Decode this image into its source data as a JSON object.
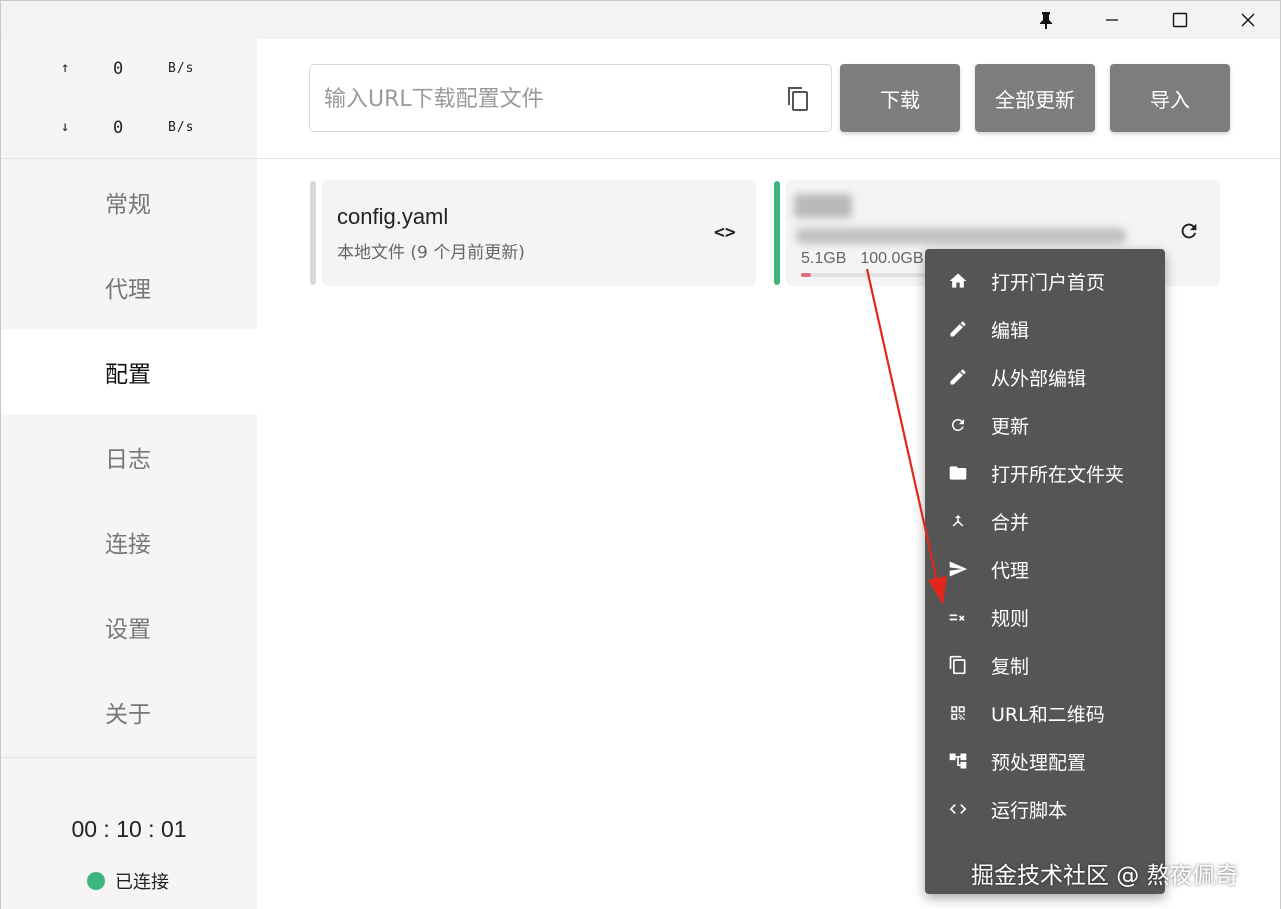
{
  "titlebar": {
    "pin_icon": "pin-icon",
    "minimize_icon": "minimize-icon",
    "maximize_icon": "maximize-icon",
    "close_icon": "close-icon"
  },
  "traffic": {
    "up": {
      "arrow": "↑",
      "value": "0",
      "unit": "B/s"
    },
    "down": {
      "arrow": "↓",
      "value": "0",
      "unit": "B/s"
    }
  },
  "nav": {
    "items": [
      {
        "label": "常规"
      },
      {
        "label": "代理"
      },
      {
        "label": "配置"
      },
      {
        "label": "日志"
      },
      {
        "label": "连接"
      },
      {
        "label": "设置"
      },
      {
        "label": "关于"
      }
    ],
    "active": "配置"
  },
  "status": {
    "timer": "00 : 10 : 01",
    "connection": "已连接",
    "connection_color": "#3db67c"
  },
  "toolbar": {
    "url_placeholder": "输入URL下载配置文件",
    "url_value": "",
    "download_label": "下载",
    "update_all_label": "全部更新",
    "import_label": "导入"
  },
  "profiles": [
    {
      "name": "config.yaml",
      "subtitle": "本地文件 (9 个月前更新)",
      "icon": "code-icon"
    },
    {
      "used": "5.1GB",
      "total": "100.0GB",
      "usage_fraction": 0.051,
      "icon": "refresh-icon",
      "accent": "#3db67c"
    }
  ],
  "context_menu": {
    "items": [
      {
        "label": "打开门户首页",
        "icon": "home-icon"
      },
      {
        "label": "编辑",
        "icon": "pencil-icon"
      },
      {
        "label": "从外部编辑",
        "icon": "pencil-icon"
      },
      {
        "label": "更新",
        "icon": "refresh-icon"
      },
      {
        "label": "打开所在文件夹",
        "icon": "folder-icon"
      },
      {
        "label": "合并",
        "icon": "merge-icon"
      },
      {
        "label": "代理",
        "icon": "send-icon"
      },
      {
        "label": "规则",
        "icon": "rule-icon"
      },
      {
        "label": "复制",
        "icon": "copy-icon"
      },
      {
        "label": "URL和二维码",
        "icon": "qrcode-icon"
      },
      {
        "label": "预处理配置",
        "icon": "tree-icon"
      },
      {
        "label": "运行脚本",
        "icon": "code-icon"
      }
    ]
  },
  "watermark": "掘金技术社区 @ 熬夜佩奇"
}
